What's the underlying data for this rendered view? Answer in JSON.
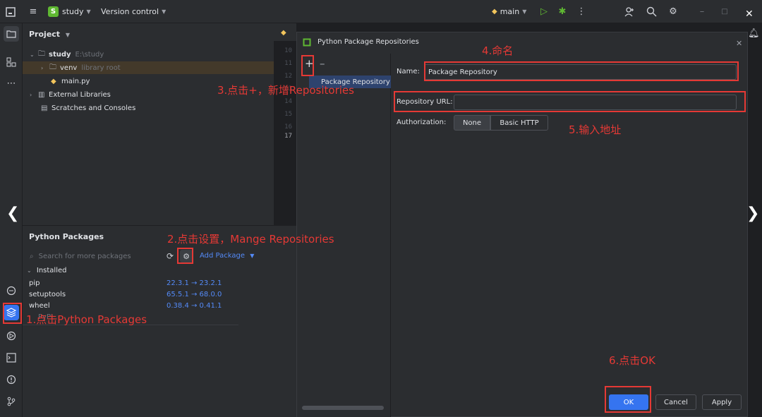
{
  "topbar": {
    "project_name": "study",
    "project_initial": "S",
    "vcs_label": "Version control",
    "run_config": "main"
  },
  "project_panel": {
    "title": "Project",
    "root_name": "study",
    "root_path": "E:\\study",
    "venv_name": "venv",
    "venv_note": "library root",
    "file_name": "main.py",
    "external_libraries": "External Libraries",
    "scratches": "Scratches and Consoles"
  },
  "editor": {
    "line_numbers": [
      "10",
      "11",
      "12",
      "13",
      "14",
      "15",
      "16",
      "17"
    ]
  },
  "packages_panel": {
    "title": "Python Packages",
    "search_placeholder": "Search for more packages",
    "add_package": "Add Package",
    "installed_label": "Installed",
    "packages": [
      {
        "name": "pip",
        "version": "22.3.1 → 23.2.1"
      },
      {
        "name": "setuptools",
        "version": "65.5.1 → 68.0.0"
      },
      {
        "name": "wheel",
        "version": "0.38.4 → 0.41.1"
      }
    ],
    "partial_item": "PyPI"
  },
  "dialog": {
    "title": "Python Package Repositories",
    "list_item": "Package Repository",
    "name_label": "Name:",
    "name_value": "Package Repository",
    "url_label": "Repository URL:",
    "url_value": "",
    "auth_label": "Authorization:",
    "auth_none": "None",
    "auth_basic": "Basic HTTP",
    "ok": "OK",
    "cancel": "Cancel",
    "apply": "Apply"
  },
  "annotations": {
    "step1": "1.点击Python Packages",
    "step2": "2.点击设置，Mange Repositories",
    "step3": "3.点击+，新增Repositories",
    "step4": "4.命名",
    "step5": "5.输入地址",
    "step6": "6.点击OK"
  },
  "colors": {
    "annotation_red": "#e53935",
    "accent_blue": "#3574f0",
    "version_blue": "#548af7"
  }
}
